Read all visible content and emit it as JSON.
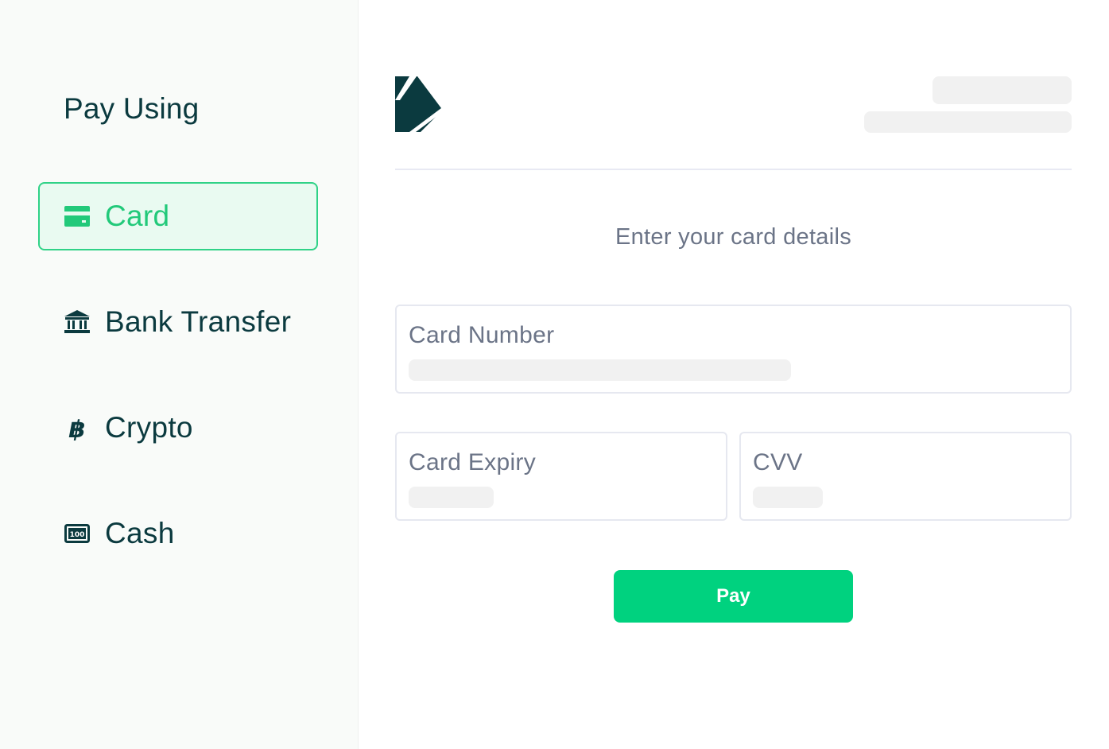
{
  "sidebar": {
    "title": "Pay Using",
    "methods": [
      {
        "label": "Card",
        "icon": "credit-card-icon",
        "active": true
      },
      {
        "label": "Bank Transfer",
        "icon": "bank-icon",
        "active": false
      },
      {
        "label": "Crypto",
        "icon": "bitcoin-icon",
        "active": false
      },
      {
        "label": "Cash",
        "icon": "cash-note-icon",
        "active": false
      }
    ]
  },
  "main": {
    "logo_icon": "brand-logo-icon",
    "heading": "Enter your card details",
    "fields": {
      "card_number": {
        "label": "Card Number"
      },
      "card_expiry": {
        "label": "Card Expiry"
      },
      "cvv": {
        "label": "CVV"
      }
    },
    "pay_label": "Pay"
  },
  "colors": {
    "brand_dark": "#0b3a3f",
    "accent_green": "#00d27f",
    "active_bg": "#e9faf1",
    "muted_text": "#6b7487"
  }
}
